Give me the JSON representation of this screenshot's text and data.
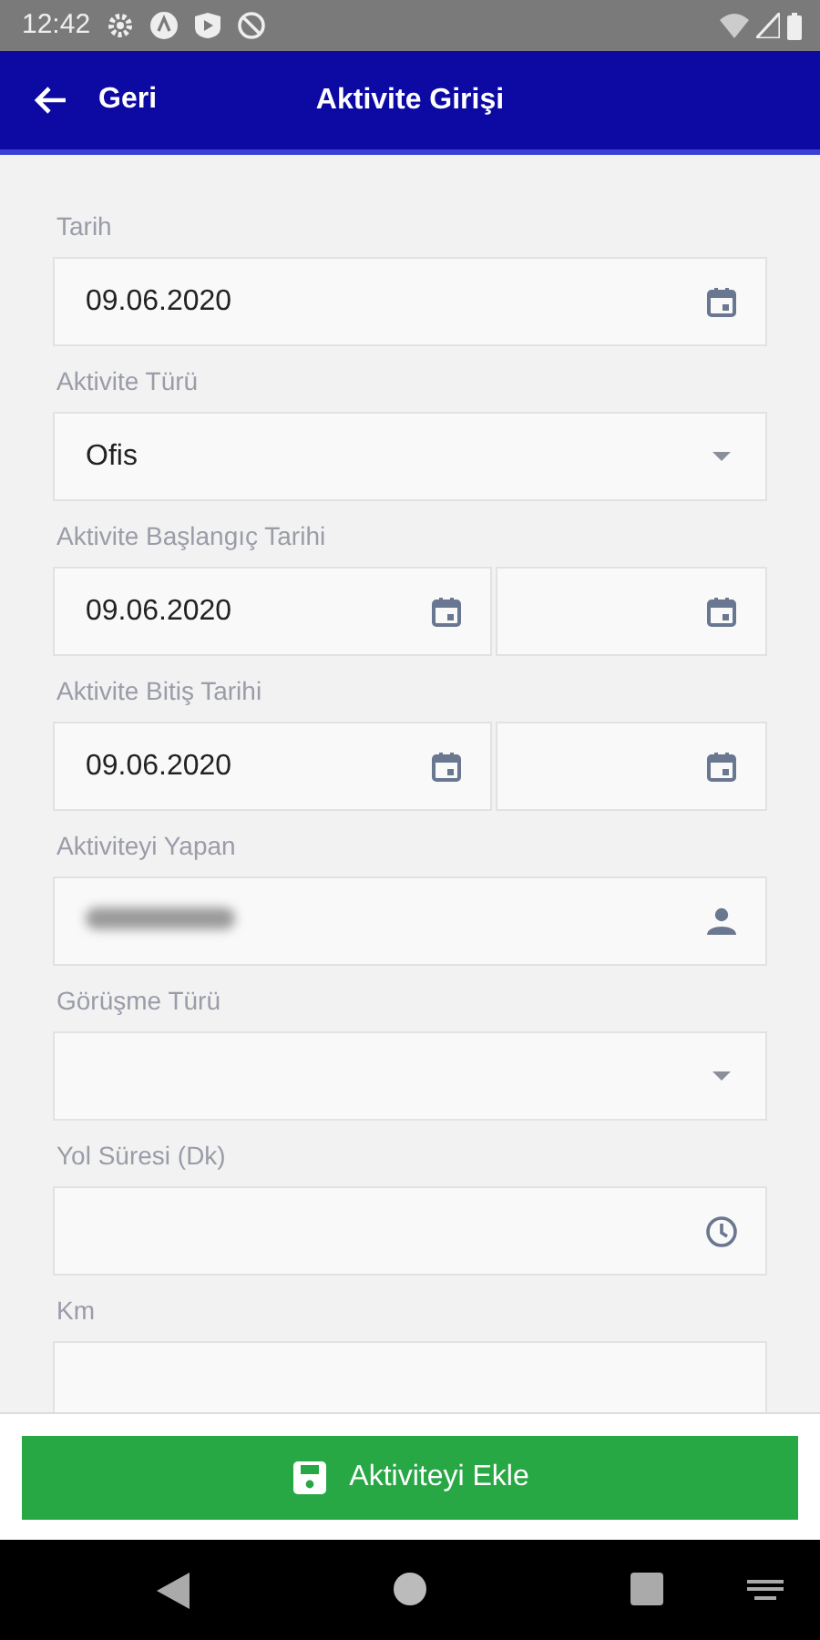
{
  "status_bar": {
    "time": "12:42"
  },
  "header": {
    "back_label": "Geri",
    "title": "Aktivite Girişi"
  },
  "fields": [
    {
      "label": "Tarih",
      "kind": "date",
      "value": "09.06.2020"
    },
    {
      "label": "Aktivite Türü",
      "kind": "select",
      "value": "Ofis"
    },
    {
      "label": "Aktivite Başlangıç Tarihi",
      "kind": "datetime",
      "value": "09.06.2020"
    },
    {
      "label": "Aktivite Bitiş Tarihi",
      "kind": "datetime",
      "value": "09.06.2020"
    },
    {
      "label": "Aktiviteyi Yapan",
      "kind": "person",
      "redacted": true
    },
    {
      "label": "Görüşme Türü",
      "kind": "select"
    },
    {
      "label": "Yol Süresi (Dk)",
      "kind": "time"
    },
    {
      "label": "Km",
      "kind": "text"
    }
  ],
  "submit_button": {
    "label": "Aktiviteyi Ekle"
  }
}
